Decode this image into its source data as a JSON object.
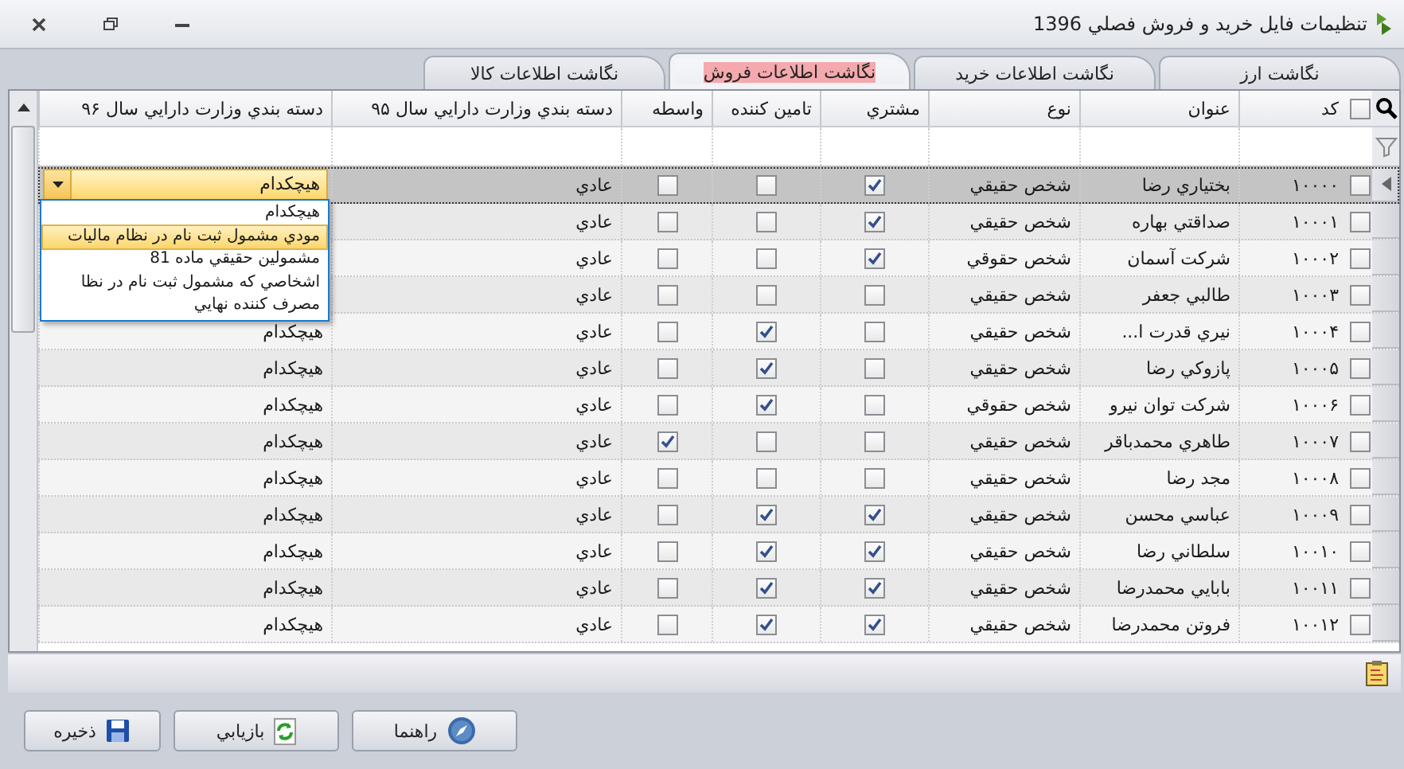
{
  "window": {
    "title": "تنظیمات فایل خرید و فروش فصلي 1396"
  },
  "tabs": [
    {
      "label": "نگاشت ارز",
      "selected": false
    },
    {
      "label": "نگاشت اطلاعات خرید",
      "selected": false
    },
    {
      "label": "نگاشت اطلاعات فروش",
      "selected": true
    },
    {
      "label": "نگاشت اطلاعات کالا",
      "selected": false
    }
  ],
  "grid": {
    "select_all_checked": false,
    "columns": [
      "کد",
      "عنوان",
      "نوع",
      "مشتري",
      "تامین کننده",
      "واسطه",
      "دسته بندي وزارت دارايي سال ۹۵",
      "دسته بندي وزارت دارايي سال ۹۶"
    ],
    "rows": [
      {
        "selected": true,
        "checked": false,
        "code": "۱۰۰۰۰",
        "title": "بختیاري رضا",
        "type": "شخص حقیقي",
        "customer": true,
        "supplier": false,
        "broker": false,
        "category_95": "عادي",
        "category_96": "هیچکدام"
      },
      {
        "selected": false,
        "checked": false,
        "code": "۱۰۰۰۱",
        "title": "صداقتي بهاره",
        "type": "شخص حقیقي",
        "customer": true,
        "supplier": false,
        "broker": false,
        "category_95": "عادي"
      },
      {
        "selected": false,
        "checked": false,
        "code": "۱۰۰۰۲",
        "title": "شرکت آسمان",
        "type": "شخص حقوقي",
        "customer": true,
        "supplier": false,
        "broker": false,
        "category_95": "عادي"
      },
      {
        "selected": false,
        "checked": false,
        "code": "۱۰۰۰۳",
        "title": "طالبي جعفر",
        "type": "شخص حقیقي",
        "customer": false,
        "supplier": false,
        "broker": false,
        "category_95": "عادي"
      },
      {
        "selected": false,
        "checked": false,
        "code": "۱۰۰۰۴",
        "title": "نیري قدرت ا...",
        "type": "شخص حقیقي",
        "customer": false,
        "supplier": true,
        "broker": false,
        "category_95": "عادي",
        "category_96": "هیچکدام"
      },
      {
        "selected": false,
        "checked": false,
        "code": "۱۰۰۰۵",
        "title": "پازوکي رضا",
        "type": "شخص حقیقي",
        "customer": false,
        "supplier": true,
        "broker": false,
        "category_95": "عادي",
        "category_96": "هیچکدام"
      },
      {
        "selected": false,
        "checked": false,
        "code": "۱۰۰۰۶",
        "title": "شرکت توان نیرو",
        "type": "شخص حقوقي",
        "customer": false,
        "supplier": true,
        "broker": false,
        "category_95": "عادي",
        "category_96": "هیچکدام"
      },
      {
        "selected": false,
        "checked": false,
        "code": "۱۰۰۰۷",
        "title": "طاهري محمدباقر",
        "type": "شخص حقیقي",
        "customer": false,
        "supplier": false,
        "broker": true,
        "category_95": "عادي",
        "category_96": "هیچکدام"
      },
      {
        "selected": false,
        "checked": false,
        "code": "۱۰۰۰۸",
        "title": "مجد رضا",
        "type": "شخص حقیقي",
        "customer": false,
        "supplier": false,
        "broker": false,
        "category_95": "عادي",
        "category_96": "هیچکدام"
      },
      {
        "selected": false,
        "checked": false,
        "code": "۱۰۰۰۹",
        "title": "عباسي محسن",
        "type": "شخص حقیقي",
        "customer": true,
        "supplier": true,
        "broker": false,
        "category_95": "عادي",
        "category_96": "هیچکدام"
      },
      {
        "selected": false,
        "checked": false,
        "code": "۱۰۰۱۰",
        "title": "سلطاني رضا",
        "type": "شخص حقیقي",
        "customer": true,
        "supplier": true,
        "broker": false,
        "category_95": "عادي",
        "category_96": "هیچکدام"
      },
      {
        "selected": false,
        "checked": false,
        "code": "۱۰۰۱۱",
        "title": "بابایي محمدرضا",
        "type": "شخص حقیقي",
        "customer": true,
        "supplier": true,
        "broker": false,
        "category_95": "عادي",
        "category_96": "هیچکدام"
      },
      {
        "selected": false,
        "checked": false,
        "code": "۱۰۰۱۲",
        "title": "فروتن محمدرضا",
        "type": "شخص حقیقي",
        "customer": true,
        "supplier": true,
        "broker": false,
        "category_95": "عادي",
        "category_96": "هیچکدام"
      }
    ]
  },
  "dropdown": {
    "options": [
      {
        "label": "هیچکدام",
        "selected": false
      },
      {
        "label": "مودي مشمول ثبت نام در نظام مالیات",
        "selected": true
      },
      {
        "label": "مشمولین حقیقي ماده 81",
        "selected": false
      },
      {
        "label": "اشخاصي که مشمول ثبت نام در نظا",
        "selected": false
      },
      {
        "label": "مصرف کننده نهایي",
        "selected": false
      }
    ]
  },
  "buttons": [
    {
      "label": "راهنما",
      "kind": "help"
    },
    {
      "label": "بازیابي",
      "kind": "refresh"
    },
    {
      "label": "ذخیره",
      "kind": "save"
    }
  ]
}
